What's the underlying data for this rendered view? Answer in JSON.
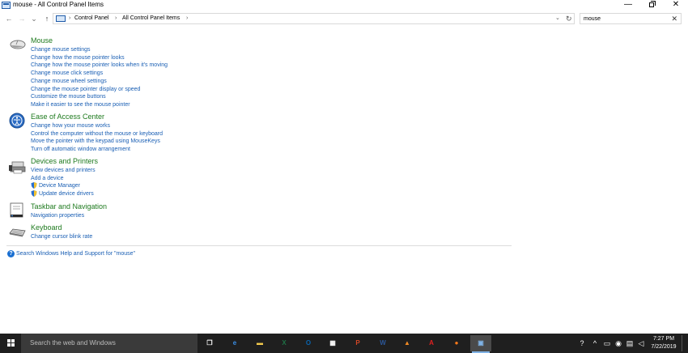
{
  "window": {
    "title": "mouse - All Control Panel Items",
    "minimize_glyph": "—",
    "close_glyph": "✕"
  },
  "nav": {
    "back_glyph": "←",
    "forward_glyph": "→",
    "recent_glyph": "⌄",
    "up_glyph": "↑",
    "breadcrumb": [
      {
        "label": "Control Panel",
        "sep": "›"
      },
      {
        "label": "All Control Panel Items",
        "sep": "›"
      }
    ],
    "lead_sep": "›",
    "dropdown_glyph": "⌄",
    "refresh_glyph": "↻",
    "search_value": "mouse",
    "search_clear_glyph": "✕"
  },
  "results": [
    {
      "title": "Mouse",
      "links": [
        "Change mouse settings",
        "Change how the mouse pointer looks",
        "Change how the mouse pointer looks when it's moving",
        "Change mouse click settings",
        "Change mouse wheel settings",
        "Change the mouse pointer display or speed",
        "Customize the mouse buttons",
        "Make it easier to see the mouse pointer"
      ]
    },
    {
      "title": "Ease of Access Center",
      "links": [
        "Change how your mouse works",
        "Control the computer without the mouse or keyboard",
        "Move the pointer with the keypad using MouseKeys",
        "Turn off automatic window arrangement"
      ]
    },
    {
      "title": "Devices and Printers",
      "links": [
        "View devices and printers",
        "Add a device",
        "Device Manager",
        "Update device drivers"
      ]
    },
    {
      "title": "Taskbar and Navigation",
      "links": [
        "Navigation properties"
      ]
    },
    {
      "title": "Keyboard",
      "links": [
        "Change cursor blink rate"
      ]
    }
  ],
  "help": {
    "glyph": "?",
    "text": "Search Windows Help and Support for \"mouse\""
  },
  "taskbar": {
    "search_placeholder": "Search the web and Windows",
    "apps": [
      {
        "name": "task-view",
        "glyph": "❐",
        "color": "#ffffff"
      },
      {
        "name": "edge",
        "glyph": "e",
        "color": "#3a8ee6"
      },
      {
        "name": "file-explorer",
        "glyph": "▬",
        "color": "#f2c94c"
      },
      {
        "name": "excel",
        "glyph": "X",
        "color": "#1e7145"
      },
      {
        "name": "outlook",
        "glyph": "O",
        "color": "#0a64ad"
      },
      {
        "name": "store",
        "glyph": "▦",
        "color": "#ffffff"
      },
      {
        "name": "powerpoint",
        "glyph": "P",
        "color": "#d24726"
      },
      {
        "name": "word",
        "glyph": "W",
        "color": "#2b579a"
      },
      {
        "name": "vlc",
        "glyph": "▲",
        "color": "#f08a24"
      },
      {
        "name": "acrobat",
        "glyph": "A",
        "color": "#e02020"
      },
      {
        "name": "firefox",
        "glyph": "●",
        "color": "#ff7a1a"
      },
      {
        "name": "control-panel",
        "glyph": "▣",
        "color": "#7fb2e5"
      }
    ],
    "tray": [
      {
        "name": "help-tray",
        "glyph": "?"
      },
      {
        "name": "chevron-up",
        "glyph": "^"
      },
      {
        "name": "meet-now",
        "glyph": "▭"
      },
      {
        "name": "security",
        "glyph": "◉"
      },
      {
        "name": "network",
        "glyph": "▤"
      },
      {
        "name": "volume",
        "glyph": "◁"
      },
      {
        "name": "language",
        "glyph": "▦"
      }
    ],
    "time": "7:27 PM",
    "date": "7/22/2019"
  }
}
